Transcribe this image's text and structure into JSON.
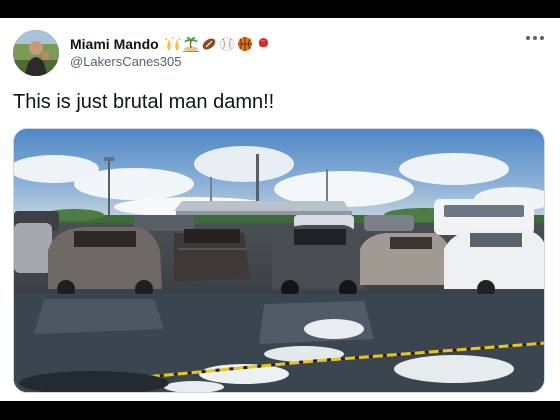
{
  "tweet": {
    "display_name": "Miami Mando",
    "handle": "@LakersCanes305",
    "text": "This is just brutal man damn!!",
    "name_emojis": [
      "raised-hands-icon",
      "palm-island-icon",
      "football-icon",
      "baseball-icon",
      "basketball-icon",
      "boxing-glove-icon"
    ]
  },
  "menu": {
    "icon": "more-options-icon"
  },
  "photo": {
    "subject": "burned-cars-parking-lot-photo"
  },
  "colors": {
    "text_primary": "#0f1419",
    "text_secondary": "#536471",
    "card_bg": "#ffffff",
    "page_bg": "#000000"
  }
}
